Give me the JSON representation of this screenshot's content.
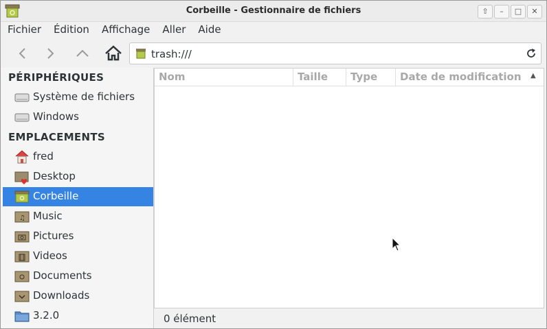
{
  "window": {
    "title": "Corbeille - Gestionnaire de fichiers"
  },
  "menubar": {
    "items": [
      "Fichier",
      "Édition",
      "Affichage",
      "Aller",
      "Aide"
    ]
  },
  "address": {
    "value": "trash:///"
  },
  "sidebar": {
    "sections": [
      {
        "title": "PÉRIPHÉRIQUES",
        "items": [
          {
            "label": "Système de fichiers",
            "icon": "drive-icon"
          },
          {
            "label": "Windows",
            "icon": "drive-icon"
          }
        ]
      },
      {
        "title": "EMPLACEMENTS",
        "items": [
          {
            "label": "fred",
            "icon": "home-folder-icon"
          },
          {
            "label": "Desktop",
            "icon": "desktop-folder-icon"
          },
          {
            "label": "Corbeille",
            "icon": "trash-icon",
            "selected": true
          },
          {
            "label": "Music",
            "icon": "music-folder-icon"
          },
          {
            "label": "Pictures",
            "icon": "pictures-folder-icon"
          },
          {
            "label": "Videos",
            "icon": "videos-folder-icon"
          },
          {
            "label": "Documents",
            "icon": "documents-folder-icon"
          },
          {
            "label": "Downloads",
            "icon": "downloads-folder-icon"
          },
          {
            "label": "3.2.0",
            "icon": "folder-icon"
          }
        ]
      }
    ]
  },
  "columns": [
    "Nom",
    "Taille",
    "Type",
    "Date de modification"
  ],
  "sort_indicator": "▲",
  "status": {
    "text": "0 élément"
  },
  "colors": {
    "selection": "#3584e4"
  }
}
